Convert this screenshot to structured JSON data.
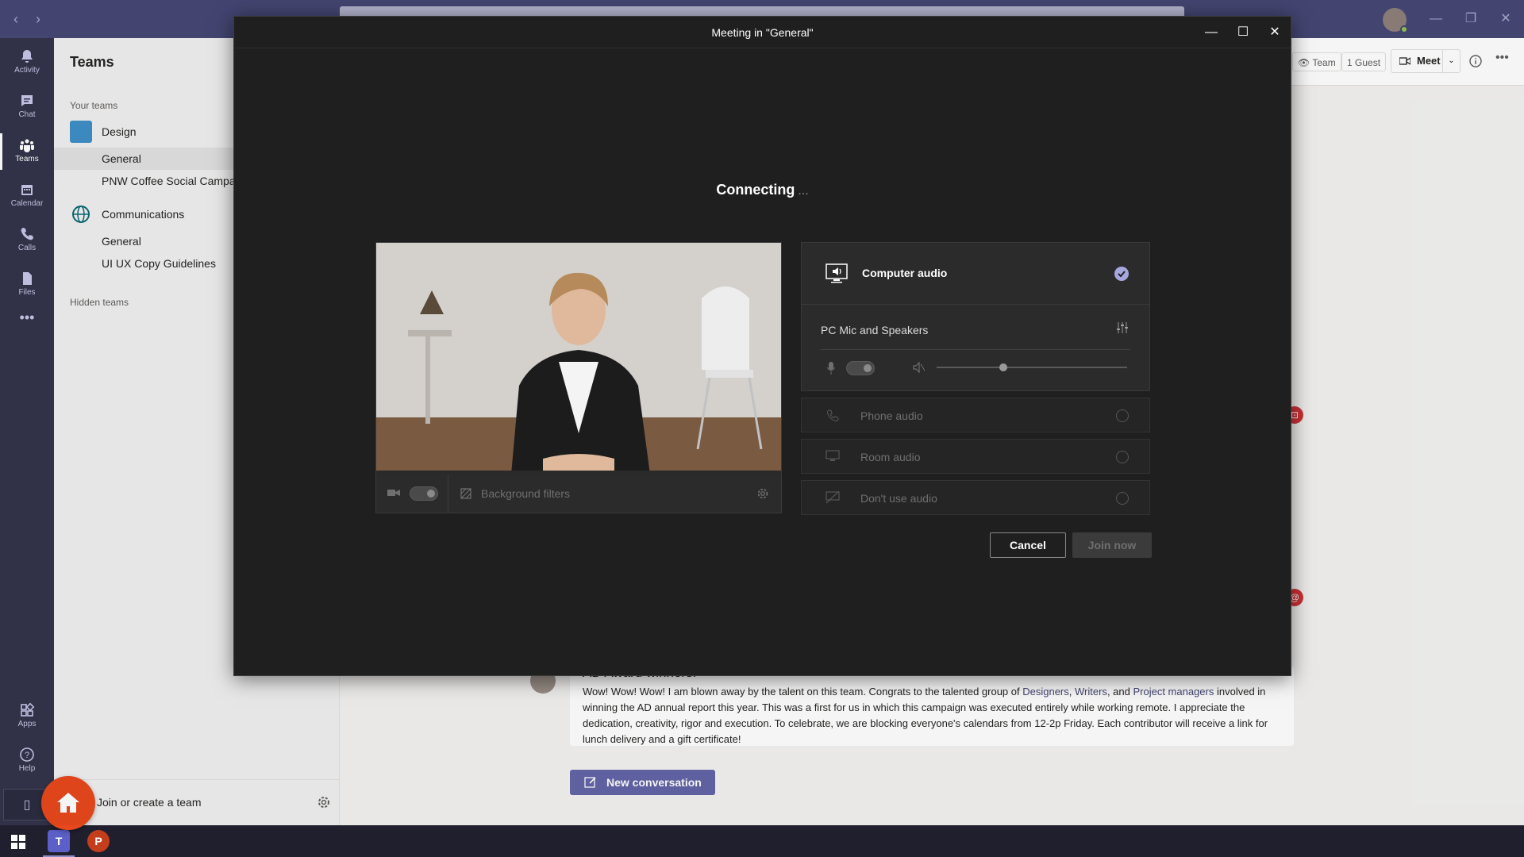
{
  "rail": {
    "items": [
      {
        "label": "Activity",
        "icon": "bell-icon"
      },
      {
        "label": "Chat",
        "icon": "chat-icon"
      },
      {
        "label": "Teams",
        "icon": "teams-icon"
      },
      {
        "label": "Calendar",
        "icon": "calendar-icon"
      },
      {
        "label": "Calls",
        "icon": "phone-icon"
      },
      {
        "label": "Files",
        "icon": "file-icon"
      },
      {
        "label": "Apps",
        "icon": "apps-icon"
      },
      {
        "label": "Help",
        "icon": "help-icon"
      }
    ]
  },
  "teams_panel": {
    "header": "Teams",
    "your_teams": "Your teams",
    "hidden_teams": "Hidden teams",
    "teams": [
      {
        "name": "Design",
        "icon_color": "#3e8fc7",
        "channels": [
          "General",
          "PNW Coffee Social Campaign"
        ]
      },
      {
        "name": "Communications",
        "icon_color": "#0a6a74",
        "channels": [
          "General",
          "UI UX Copy Guidelines"
        ]
      }
    ],
    "join_label": "Join or create a team"
  },
  "channel_header": {
    "team_chip": "Team",
    "guest_chip": "1 Guest",
    "meet_label": "Meet"
  },
  "post": {
    "title": "AD Award winners!",
    "body_1": "Wow! Wow! Wow! I am blown away by the talent on this team. Congrats to the talented group of ",
    "mention_1": "Designers",
    "sep_1": ", ",
    "mention_2": "Writers",
    "sep_2": ", and ",
    "mention_3": "Project managers",
    "body_2": " involved in winning the AD annual report this year. This was a first for us in which this campaign was executed entirely while working remote. I appreciate the dedication, creativity, rigor and execution. To celebrate, we are blocking everyone's calendars from 12-2p Friday. Each contributor will receive a link for lunch delivery and a gift certificate!"
  },
  "new_conversation": "New conversation",
  "dialog": {
    "title": "Meeting in \"General\"",
    "status": "Connecting",
    "dots": "...",
    "video": {
      "background_filters": "Background filters"
    },
    "audio": {
      "computer_audio": "Computer audio",
      "device": "PC Mic and Speakers",
      "volume_level": 0.35,
      "options": [
        {
          "label": "Phone audio",
          "icon": "phone-audio-icon"
        },
        {
          "label": "Room audio",
          "icon": "room-audio-icon"
        },
        {
          "label": "Don't use audio",
          "icon": "no-audio-icon"
        }
      ]
    },
    "cancel": "Cancel",
    "join_now": "Join now"
  },
  "taskbar": {
    "teams_letter": "T",
    "powerpoint_letter": "P"
  },
  "colors": {
    "accent": "#6264a7",
    "titlebar": "#464775",
    "rail": "#33344a",
    "dialog_bg": "#1f1f1f"
  }
}
